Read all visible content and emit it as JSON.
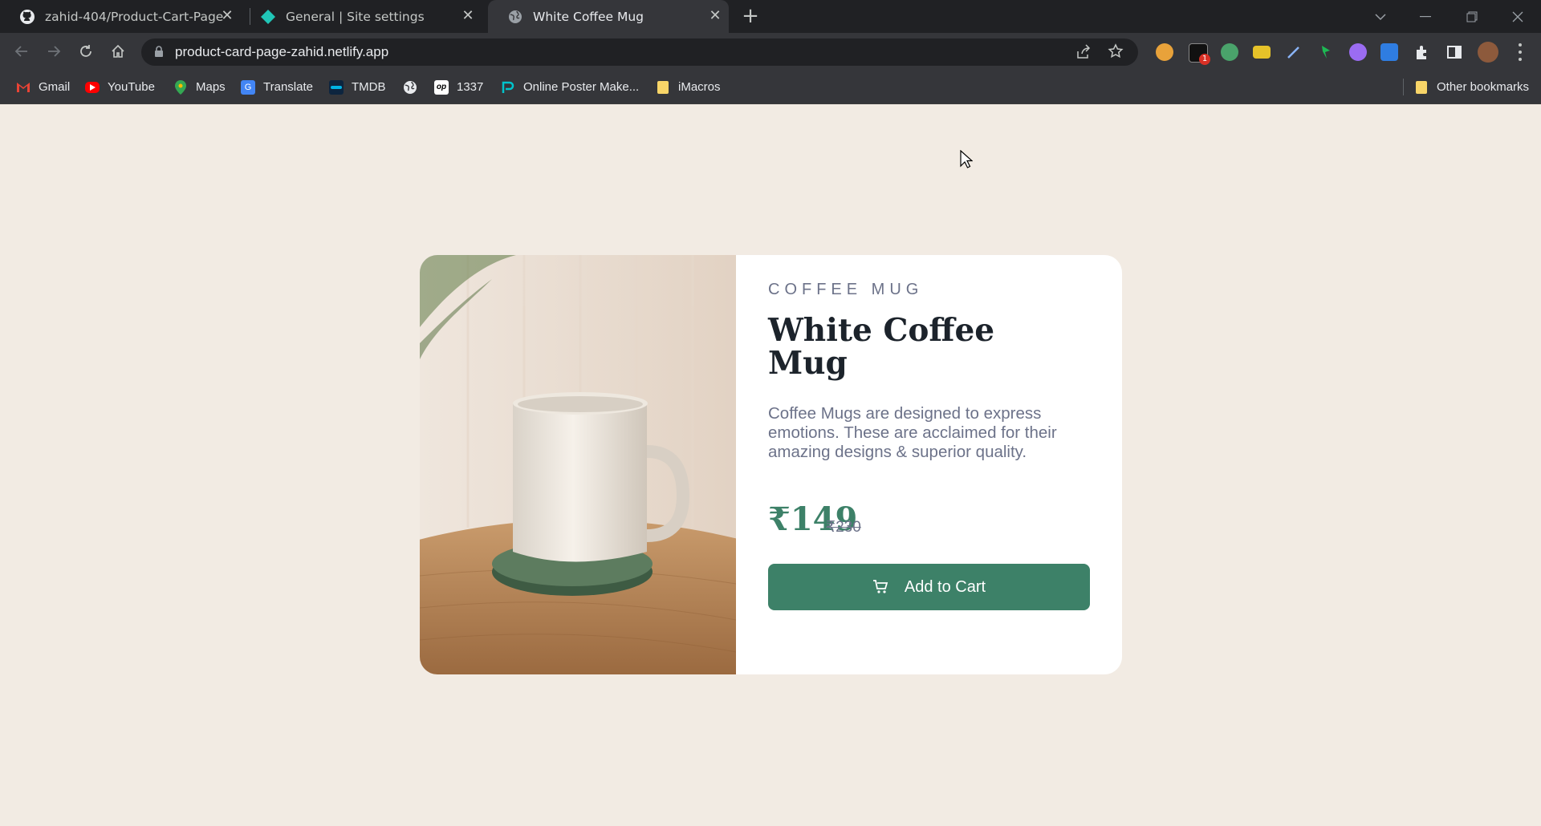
{
  "browser": {
    "tabs": [
      {
        "title": "zahid-404/Product-Cart-Page",
        "icon": "github-icon",
        "active": false
      },
      {
        "title": "General | Site settings",
        "icon": "netlify-icon",
        "active": false
      },
      {
        "title": "White Coffee Mug",
        "icon": "globe-icon",
        "active": true
      }
    ],
    "url": "product-card-page-zahid.netlify.app",
    "extension_badge": "1",
    "bookmarks": [
      {
        "label": "Gmail",
        "icon": "gmail-icon"
      },
      {
        "label": "YouTube",
        "icon": "youtube-icon"
      },
      {
        "label": "Maps",
        "icon": "maps-icon"
      },
      {
        "label": "Translate",
        "icon": "translate-icon"
      },
      {
        "label": "TMDB",
        "icon": "tmdb-icon"
      },
      {
        "label": "",
        "icon": "globe-icon"
      },
      {
        "label": "1337",
        "icon": "op-icon"
      },
      {
        "label": "Online Poster Make...",
        "icon": "poster-icon"
      },
      {
        "label": "iMacros",
        "icon": "folder-icon"
      }
    ],
    "other_bookmarks": "Other bookmarks"
  },
  "product": {
    "category": "COFFEE MUG",
    "name": "White Coffee Mug",
    "description": "Coffee Mugs are designed to express emotions. These are acclaimed for their amazing designs & superior quality.",
    "price": "₹149",
    "original_price": "₹230",
    "cta": "Add to Cart"
  },
  "colors": {
    "page_bg": "#f2ebe3",
    "accent": "#3d8168",
    "text_dark": "#1c232b",
    "text_muted": "#6c7289"
  }
}
